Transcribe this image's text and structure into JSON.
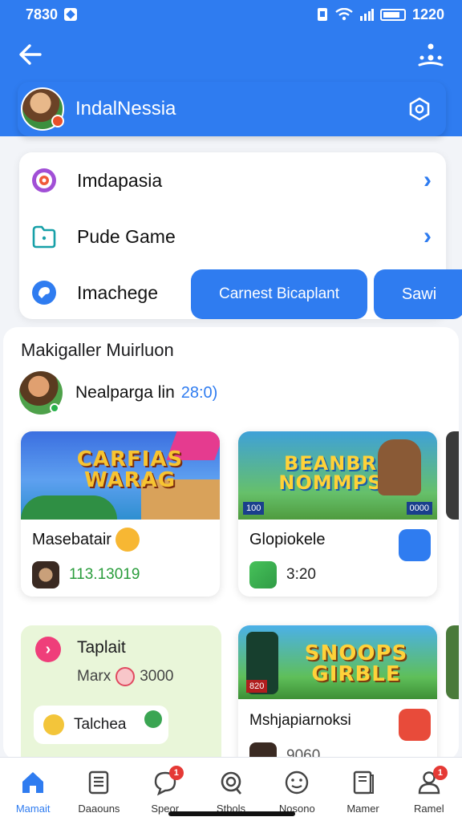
{
  "status": {
    "time": "7830",
    "clock": "1220"
  },
  "profile": {
    "name": "IndalNessia"
  },
  "menu": {
    "items": [
      {
        "label": "Imdapasia"
      },
      {
        "label": "Pude Game"
      },
      {
        "label": "Imachege"
      }
    ],
    "primary_button": "Carnest Bicaplant",
    "save_button": "Sawi"
  },
  "section": {
    "title": "Makigaller Muirluon",
    "user_name": "Nealparga lin",
    "user_time": "28:0)"
  },
  "games": [
    {
      "thumb_title": "CARFIAS WARAG",
      "name": "Masebatair",
      "meta": "113.13019"
    },
    {
      "thumb_title": "BEANBR NOMMPS",
      "name": "Glopiokele",
      "meta": "3:20",
      "tag_left": "100",
      "tag_right": "0000"
    },
    {
      "thumb_title": "SNOOPS GIRBLE",
      "name": "Mshjapiarnoksi",
      "meta": "9060",
      "tag_left": "820"
    }
  ],
  "promo": {
    "title": "Taplait",
    "sub_left": "Marx",
    "sub_right": "3000",
    "pill_label": "Talchea"
  },
  "nav": {
    "items": [
      {
        "label": "Mamait"
      },
      {
        "label": "Daaouns"
      },
      {
        "label": "Speor",
        "badge": "1"
      },
      {
        "label": "Stbols"
      },
      {
        "label": "Nosono"
      },
      {
        "label": "Mamer"
      },
      {
        "label": "Ramel",
        "badge": "1"
      }
    ]
  },
  "colors": {
    "accent": "#2f7cf0",
    "badge": "#e53935",
    "promo_bg": "#e9f6d9"
  }
}
